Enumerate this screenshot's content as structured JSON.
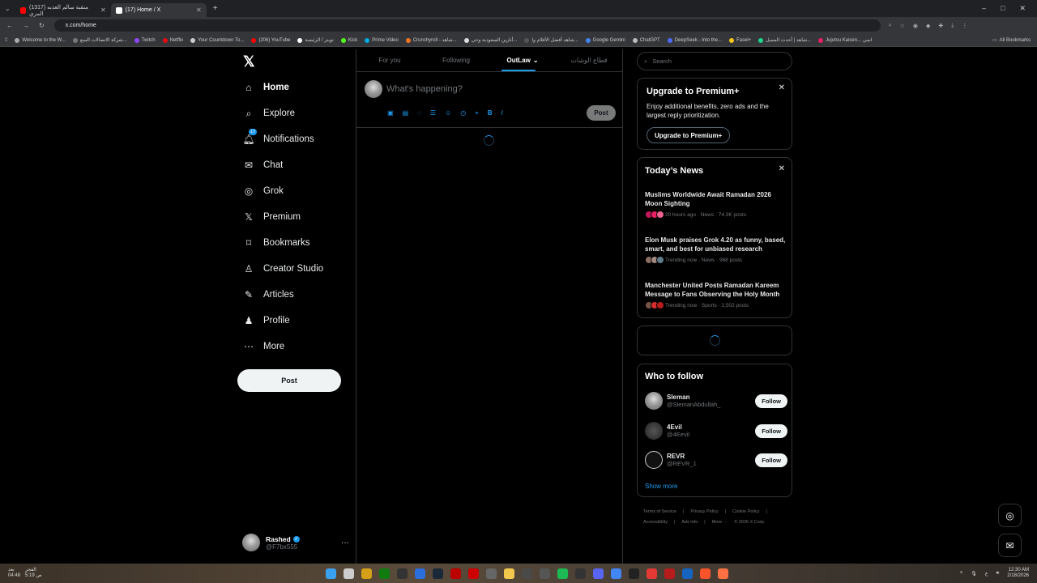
{
  "browser": {
    "tabs": [
      {
        "title": "(1317) منقبة سالم العذبه المري",
        "active": false
      },
      {
        "title": "(17) Home / X",
        "active": true
      }
    ],
    "new_tab": "+",
    "window_controls": [
      "–",
      "□",
      "✕"
    ],
    "url": "x.com/home",
    "bookmarks": [
      "Welcome to the W...",
      "شركة الاتصالات السع...",
      "Twitch",
      "Netflix",
      "Your Countdown To...",
      "(206) YouTube",
      "تويتر / الرئيسة",
      "Kick",
      "Prime Video",
      "Crunchyroll - شاهد...",
      "أنارين السعودية وحي...",
      "شاهد أفضل الأفلام وا...",
      "Google Gemini",
      "ChatGPT",
      "DeepSeek - Into the...",
      "Fasel+",
      "شاهد | أحدث المسل...",
      "Jujutsu Kaisen... انمي"
    ],
    "all_bookmarks": "All Bookmarks"
  },
  "nav": {
    "items": [
      {
        "label": "Home",
        "icon": "home-icon",
        "glyph": "⌂"
      },
      {
        "label": "Explore",
        "icon": "search-icon",
        "glyph": "⌕"
      },
      {
        "label": "Notifications",
        "icon": "bell-icon",
        "glyph": "♢"
      },
      {
        "label": "Chat",
        "icon": "mail-icon",
        "glyph": "✉"
      },
      {
        "label": "Grok",
        "icon": "grok-icon",
        "glyph": "◎"
      },
      {
        "label": "Premium",
        "icon": "x-premium-icon",
        "glyph": "𝕏"
      },
      {
        "label": "Bookmarks",
        "icon": "bookmark-icon",
        "glyph": "⌑"
      },
      {
        "label": "Creator Studio",
        "icon": "creator-icon",
        "glyph": "♙"
      },
      {
        "label": "Articles",
        "icon": "article-icon",
        "glyph": "✎"
      },
      {
        "label": "Profile",
        "icon": "person-icon",
        "glyph": "♟"
      },
      {
        "label": "More",
        "icon": "more-icon",
        "glyph": "⋯"
      }
    ],
    "notifications_badge": "17",
    "post_button": "Post",
    "account": {
      "name": "Rashed",
      "handle": "@F7bx555",
      "more": "···"
    }
  },
  "timeline": {
    "tabs": [
      "For you",
      "Following",
      "OutLaw",
      "قطاع الوشات"
    ],
    "active_tab": "OutLaw",
    "composer_placeholder": "What's happening?",
    "composer_post": "Post"
  },
  "sidebar": {
    "search_placeholder": "Search",
    "premium": {
      "title": "Upgrade to Premium+",
      "text": "Enjoy additional benefits, zero ads and the largest reply prioritization.",
      "button": "Upgrade to Premium+"
    },
    "news": {
      "title": "Today’s News",
      "items": [
        {
          "title": "Muslims Worldwide Await Ramadan 2026 Moon Sighting",
          "meta": "20 hours ago · News · 74.3K posts"
        },
        {
          "title": "Elon Musk praises Grok 4.20 as funny, based, smart, and best for unbiased research",
          "meta": "Trending now · News · 968 posts"
        },
        {
          "title": "Manchester United Posts Ramadan Kareem Message to Fans Observing the Holy Month",
          "meta": "Trending now · Sports · 2,502 posts"
        }
      ]
    },
    "who_to_follow": {
      "title": "Who to follow",
      "users": [
        {
          "name": "Sleman",
          "handle": "@SlemanAbdullah_",
          "button": "Follow"
        },
        {
          "name": "4Evil",
          "handle": "@4Eevil",
          "button": "Follow"
        },
        {
          "name": "REVR",
          "handle": "@REVR_1",
          "button": "Follow"
        }
      ],
      "show_more": "Show more"
    },
    "footer": [
      "Terms of Service",
      "|",
      "Privacy Policy",
      "|",
      "Cookie Policy",
      "|",
      "Accessibility",
      "|",
      "Ads info",
      "|",
      "More ···",
      "© 2026 X Corp."
    ]
  },
  "taskbar": {
    "left_top": "الفجر",
    "left_time": "5:19 ص",
    "left_side": "بعد",
    "left_countdown": "04:48",
    "lang": "ع",
    "time": "12:30 AM",
    "date": "2/18/2026"
  },
  "colors": {
    "accent": "#1d9bf0",
    "background": "#000000",
    "border": "#2f3336"
  }
}
